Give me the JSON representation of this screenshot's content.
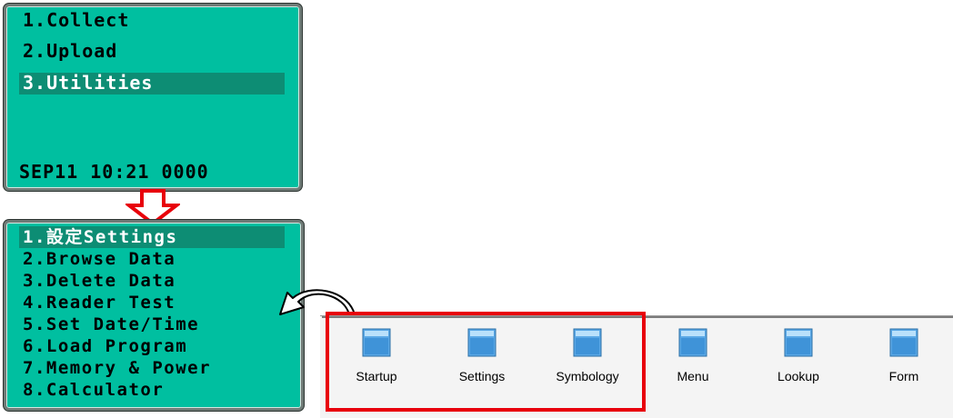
{
  "top_screen": {
    "items": [
      "1.Collect",
      "2.Upload",
      "3.Utilities"
    ],
    "selected_index": 2,
    "status": "SEP11 10:21 0000"
  },
  "bottom_screen": {
    "items": [
      "1.設定Settings",
      "2.Browse Data",
      "3.Delete Data",
      "4.Reader Test",
      "5.Set Date/Time",
      "6.Load Program",
      "7.Memory & Power",
      "8.Calculator"
    ],
    "selected_index": 0
  },
  "folders": [
    "Startup",
    "Settings",
    "Symbology",
    "Menu",
    "Lookup",
    "Form"
  ],
  "colors": {
    "lcd_background": "#00bfa0",
    "lcd_selection": "#0d8d74",
    "highlight": "#e8000a",
    "folder_icon": "#5aa8e6"
  },
  "icons": {
    "down_arrow": "down-arrow-icon",
    "curve_arrow": "curved-arrow-icon",
    "folder": "folder-icon"
  }
}
